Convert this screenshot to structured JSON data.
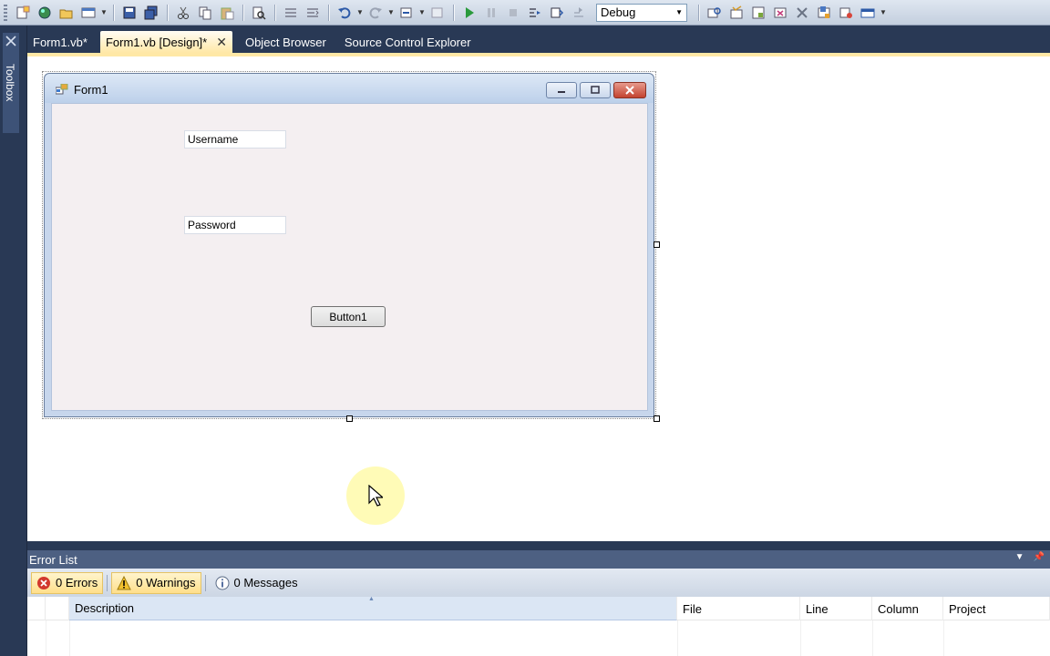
{
  "toolbar": {
    "configuration": "Debug",
    "icons": [
      "new-project-icon",
      "add-item-icon",
      "open-file-icon",
      "window-icon",
      "save-icon",
      "save-all-icon",
      "cut-icon",
      "copy-icon",
      "paste-icon",
      "find-icon",
      "comment-icon",
      "uncomment-icon",
      "undo-icon",
      "redo-icon",
      "navigate-backward-icon",
      "navigate-forward-icon",
      "start-debugging-icon",
      "pause-icon",
      "stop-icon",
      "step-into-icon",
      "step-over-icon",
      "step-out-icon",
      "solution-explorer-icon",
      "properties-icon",
      "object-browser-icon",
      "toolbox-icon",
      "extension-manager-icon",
      "command-window-icon",
      "start-page-icon"
    ]
  },
  "toolbox": {
    "label": "Toolbox"
  },
  "tabs": [
    {
      "label": "Form1.vb*"
    },
    {
      "label": "Form1.vb [Design]*",
      "close": "✕"
    },
    {
      "label": "Object Browser"
    },
    {
      "label": "Source Control Explorer"
    }
  ],
  "form": {
    "title": "Form1",
    "username_text": "Username",
    "password_text": "Password",
    "button_label": "Button1"
  },
  "error_list": {
    "title": "Error List",
    "errors": "0 Errors",
    "warnings": "0 Warnings",
    "messages": "0 Messages",
    "columns": {
      "description": "Description",
      "file": "File",
      "line": "Line",
      "column": "Column",
      "project": "Project"
    }
  },
  "colors": {
    "ide_background": "#293955",
    "active_tab": "#ffe8a6",
    "form_client": "#f4eff1",
    "close_button": "#c3432f"
  }
}
